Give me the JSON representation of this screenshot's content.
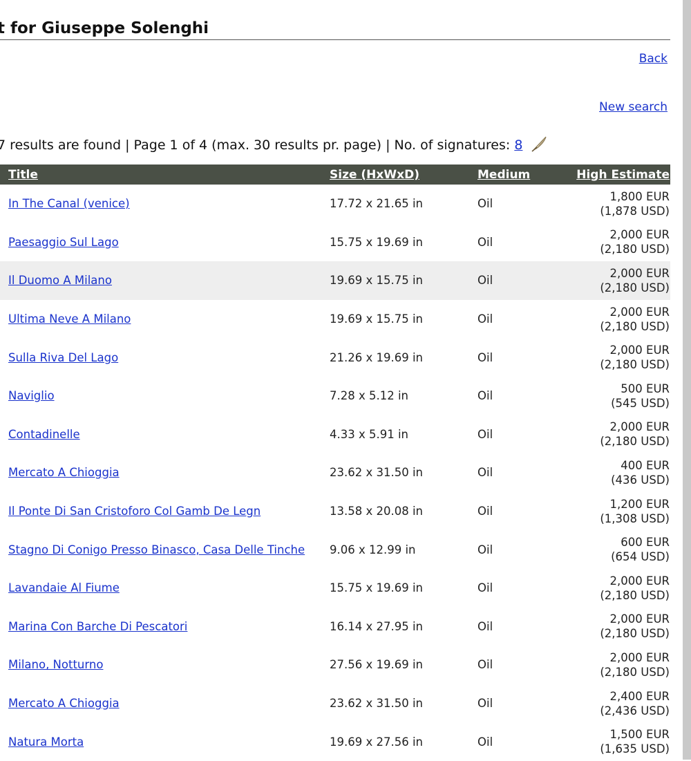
{
  "header": {
    "title": "t for Giuseppe Solenghi"
  },
  "nav": {
    "back_label": "Back",
    "new_search_label": "New search"
  },
  "summary": {
    "text": "7 results are found | Page 1 of 4 (max. 30 results pr. page) | No. of signatures:",
    "signatures_count": "8",
    "signature_icon": "quill-pen-icon"
  },
  "table": {
    "columns": {
      "title": "Title",
      "size": "Size (HxWxD)",
      "medium": "Medium",
      "high_estimate": "High Estimate"
    },
    "highlight_color": "#eeeeee",
    "header_color": "#4a5046",
    "rows": [
      {
        "title": "In The Canal (venice)",
        "size": "17.72 x 21.65 in",
        "medium": "Oil",
        "eur": "1,800 EUR",
        "usd": "(1,878 USD)"
      },
      {
        "title": "Paesaggio Sul Lago",
        "size": "15.75 x 19.69 in",
        "medium": "Oil",
        "eur": "2,000 EUR",
        "usd": "(2,180 USD)"
      },
      {
        "title": "Il Duomo A Milano",
        "size": "19.69 x 15.75 in",
        "medium": "Oil",
        "eur": "2,000 EUR",
        "usd": "(2,180 USD)"
      },
      {
        "title": "Ultima Neve A Milano",
        "size": "19.69 x 15.75 in",
        "medium": "Oil",
        "eur": "2,000 EUR",
        "usd": "(2,180 USD)"
      },
      {
        "title": "Sulla Riva Del Lago",
        "size": "21.26 x 19.69 in",
        "medium": "Oil",
        "eur": "2,000 EUR",
        "usd": "(2,180 USD)"
      },
      {
        "title": "Naviglio",
        "size": "7.28 x 5.12 in",
        "medium": "Oil",
        "eur": "500 EUR",
        "usd": "(545 USD)"
      },
      {
        "title": "Contadinelle",
        "size": "4.33 x 5.91 in",
        "medium": "Oil",
        "eur": "2,000 EUR",
        "usd": "(2,180 USD)"
      },
      {
        "title": "Mercato A Chioggia",
        "size": "23.62 x 31.50 in",
        "medium": "Oil",
        "eur": "400 EUR",
        "usd": "(436 USD)"
      },
      {
        "title": "Il Ponte Di San Cristoforo Col Gamb De Legn",
        "size": "13.58 x 20.08 in",
        "medium": "Oil",
        "eur": "1,200 EUR",
        "usd": "(1,308 USD)"
      },
      {
        "title": "Stagno Di Conigo Presso Binasco, Casa Delle Tinche",
        "size": "9.06 x 12.99 in",
        "medium": "Oil",
        "eur": "600 EUR",
        "usd": "(654 USD)"
      },
      {
        "title": "Lavandaie Al Fiume",
        "size": "15.75 x 19.69 in",
        "medium": "Oil",
        "eur": "2,000 EUR",
        "usd": "(2,180 USD)"
      },
      {
        "title": "Marina Con Barche Di Pescatori",
        "size": "16.14 x 27.95 in",
        "medium": "Oil",
        "eur": "2,000 EUR",
        "usd": "(2,180 USD)"
      },
      {
        "title": "Milano, Notturno",
        "size": "27.56 x 19.69 in",
        "medium": "Oil",
        "eur": "2,000 EUR",
        "usd": "(2,180 USD)"
      },
      {
        "title": "Mercato A Chioggia",
        "size": "23.62 x 31.50 in",
        "medium": "Oil",
        "eur": "2,400 EUR",
        "usd": "(2,436 USD)"
      },
      {
        "title": "Natura Morta",
        "size": "19.69 x 27.56 in",
        "medium": "Oil",
        "eur": "1,500 EUR",
        "usd": "(1,635 USD)"
      }
    ]
  }
}
